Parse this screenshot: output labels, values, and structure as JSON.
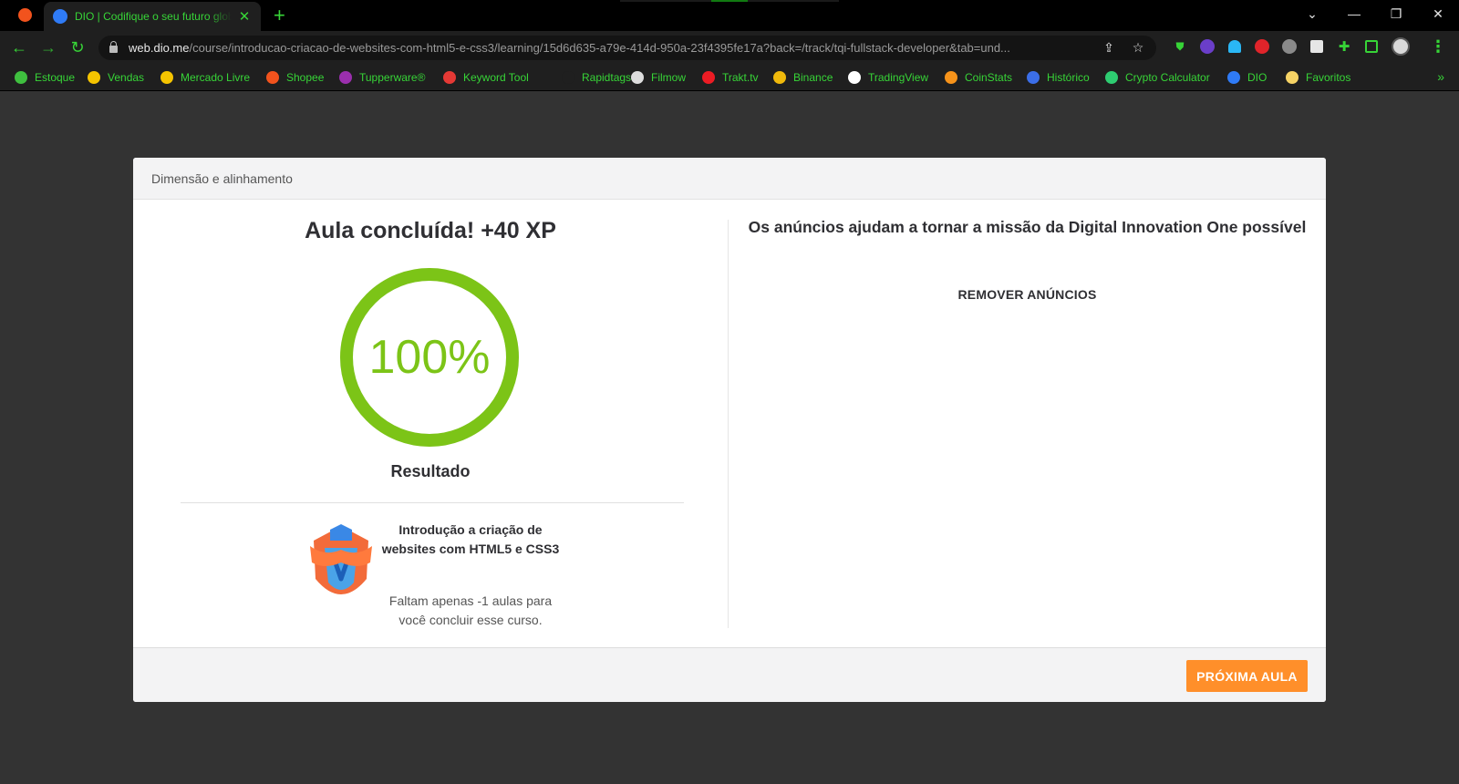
{
  "browser": {
    "tab_title": "DIO | Codifique o seu futuro global agora",
    "url_host": "web.dio.me",
    "url_path": "/course/introducao-criacao-de-websites-com-html5-e-css3/learning/15d6d635-a79e-414d-950a-23f4395fe17a?back=/track/tqi-fullstack-developer&tab=und...",
    "bookmarks": [
      {
        "label": "Estoque",
        "color": "#3fbf3f"
      },
      {
        "label": "Vendas",
        "color": "#f5c400"
      },
      {
        "label": "Mercado Livre",
        "color": "#f5c400"
      },
      {
        "label": "Shopee",
        "color": "#f2531d"
      },
      {
        "label": "Tupperware®",
        "color": "#9b2fae"
      },
      {
        "label": "Keyword Tool",
        "color": "#e53935"
      },
      {
        "label": "Rapidtags",
        "color": "#1f1f1f"
      },
      {
        "label": "Filmow",
        "color": "#dddddd"
      },
      {
        "label": "Trakt.tv",
        "color": "#ed1c24"
      },
      {
        "label": "Binance",
        "color": "#f0b90b"
      },
      {
        "label": "TradingView",
        "color": "#ffffff"
      },
      {
        "label": "CoinStats",
        "color": "#f7931a"
      },
      {
        "label": "Histórico",
        "color": "#3b6ee8"
      },
      {
        "label": "Crypto Calculator",
        "color": "#2ecc71"
      },
      {
        "label": "DIO",
        "color": "#2f7bf6"
      },
      {
        "label": "Favoritos",
        "color": "#f6d365"
      }
    ],
    "more_bookmarks": "»"
  },
  "modal": {
    "header_title": "Dimensão e alinhamento",
    "xp_title": "Aula concluída! +40 XP",
    "progress_label": "100%",
    "progress_value": 1.0,
    "progress_color": "#7cc417",
    "result_label": "Resultado",
    "course_name": "Introdução a criação de websites com HTML5 e CSS3",
    "course_remaining": "Faltam apenas -1 aulas para você concluir esse curso.",
    "ads_text": "Os anúncios ajudam a tornar a missão da Digital Innovation One possível",
    "ads_remove": "REMOVER ANÚNCIOS",
    "next_button": "PRÓXIMA AULA",
    "next_button_color": "#ff8f2a"
  }
}
